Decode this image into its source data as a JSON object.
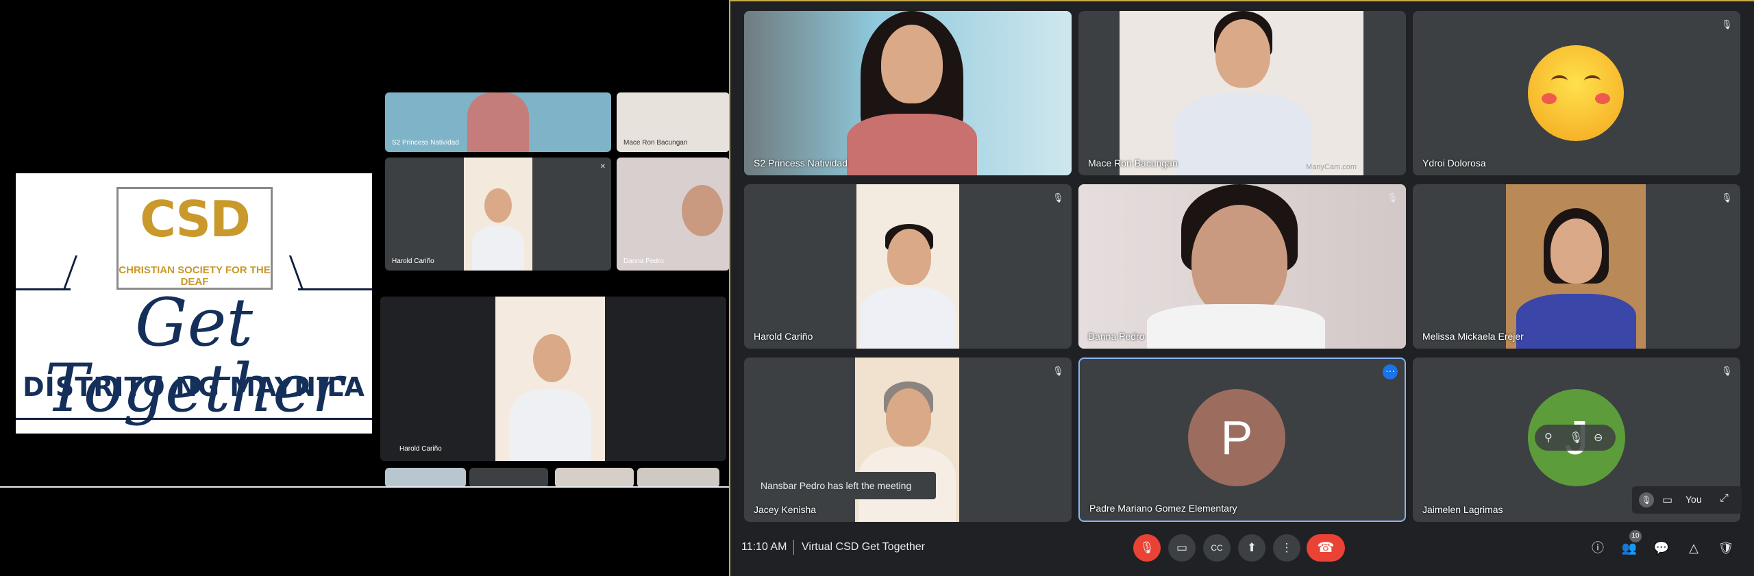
{
  "logo": {
    "csd_letters": "CSD",
    "csd_subtitle": "CHRISTIAN SOCIETY FOR THE DEAF",
    "headline": "Get Together",
    "subheadline": "DISTRITO NG  MAYNILA"
  },
  "nested_screen": {
    "tiles": [
      {
        "name": "S2 Princess Natividad"
      },
      {
        "name": "Mace Ron Bacungan"
      },
      {
        "name": "Harold Cariño"
      },
      {
        "name": "Danna Pedro"
      }
    ],
    "pinned_name": "Harold Cariño"
  },
  "meet": {
    "tiles": [
      {
        "name": "S2 Princess Natividad",
        "muted": false
      },
      {
        "name": "Mace Ron Bacungan",
        "muted": false,
        "watermark": "ManyCam.com"
      },
      {
        "name": "Ydroi Dolorosa",
        "muted": true
      },
      {
        "name": "Harold Cariño",
        "muted": true
      },
      {
        "name": "Danna Pedro",
        "muted": true
      },
      {
        "name": "Melissa Mickaela Erejer",
        "muted": true
      },
      {
        "name": "Jacey Kenisha",
        "muted": true
      },
      {
        "name": "Padre Mariano Gomez Elementary",
        "avatar_letter": "P",
        "muted": false
      },
      {
        "name": "Jaimelen Lagrimas",
        "avatar_letter": "J",
        "muted": true
      }
    ],
    "toast": "Nansbar Pedro has left the meeting",
    "you_label": "You",
    "time": "11:10 AM",
    "title": "Virtual CSD Get Together",
    "participant_count": "10",
    "colors": {
      "accent_blue": "#8ab4f8",
      "end_call_red": "#ea4335",
      "background": "#202124",
      "tile": "#3c4043"
    }
  }
}
